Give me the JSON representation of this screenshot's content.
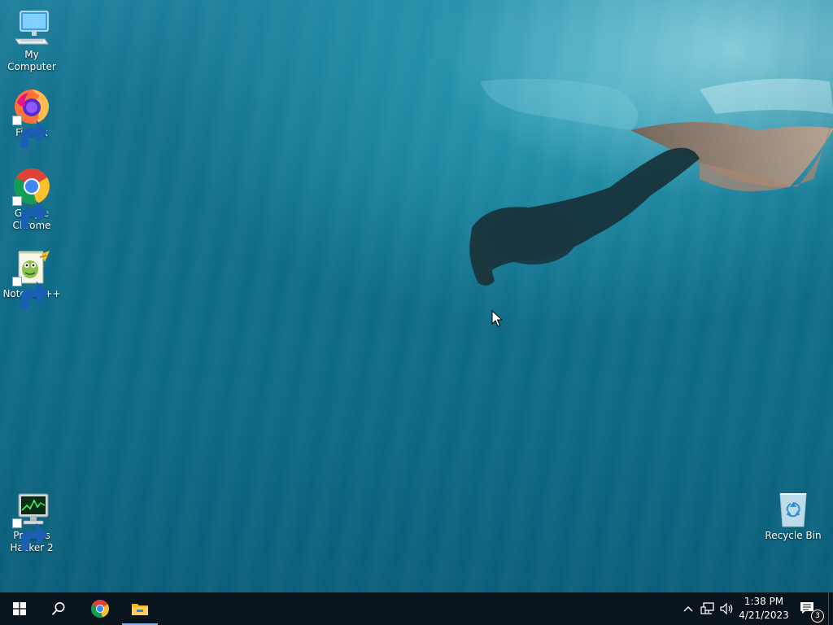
{
  "desktop": {
    "icons": [
      {
        "label": "My Computer",
        "icon": "computer-icon",
        "shortcut": false
      },
      {
        "label": "Firefox",
        "icon": "firefox-icon",
        "shortcut": true
      },
      {
        "label": "Google Chrome",
        "icon": "chrome-icon",
        "shortcut": true
      },
      {
        "label": "Notepad++",
        "icon": "notepadpp-icon",
        "shortcut": true
      },
      {
        "label": "Process Hacker 2",
        "icon": "process-hacker-icon",
        "shortcut": true
      },
      {
        "label": "Recycle Bin",
        "icon": "recycle-bin-icon",
        "shortcut": false
      }
    ]
  },
  "taskbar": {
    "start": {
      "icon": "windows-start-icon"
    },
    "search": {
      "icon": "search-icon"
    },
    "pinned": [
      {
        "app": "chrome-icon",
        "active": false
      },
      {
        "app": "file-explorer-icon",
        "active": true
      }
    ],
    "tray": {
      "icons": [
        "chevron-up-icon",
        "network-icon",
        "volume-icon"
      ],
      "time": "1:38 PM",
      "date": "4/21/2023",
      "notification_count": "3"
    }
  },
  "colors": {
    "taskbar_bg": "#0a141c",
    "water": "#0f6d89",
    "active_indicator": "#8ab4e8"
  }
}
